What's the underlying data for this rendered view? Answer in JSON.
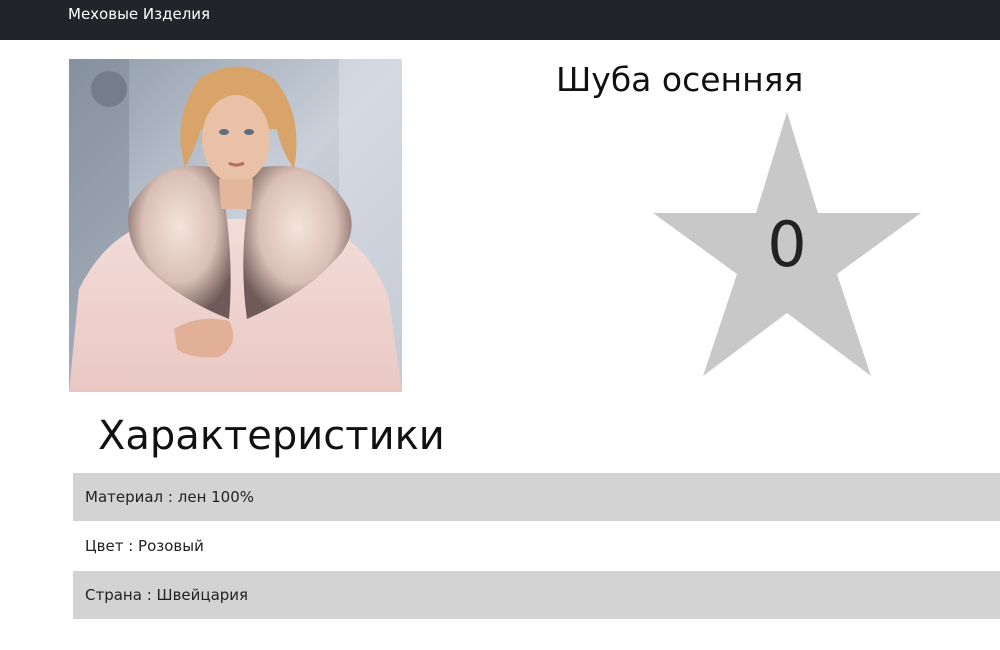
{
  "navbar": {
    "brand": "Меховые Изделия"
  },
  "product": {
    "title": "Шуба осенняя",
    "rating": "0",
    "image_alt": "Шуба осенняя"
  },
  "specs": {
    "heading": "Характеристики",
    "items": [
      {
        "label": "Материал",
        "separator": " : ",
        "value": "лен 100%"
      },
      {
        "label": "Цвет",
        "separator": " : ",
        "value": "Розовый"
      },
      {
        "label": "Страна",
        "separator": " : ",
        "value": "Швейцария"
      }
    ]
  },
  "colors": {
    "navbar_bg": "#212529",
    "star_fill": "#c8c8c8",
    "row_shade": "#d3d3d3"
  }
}
